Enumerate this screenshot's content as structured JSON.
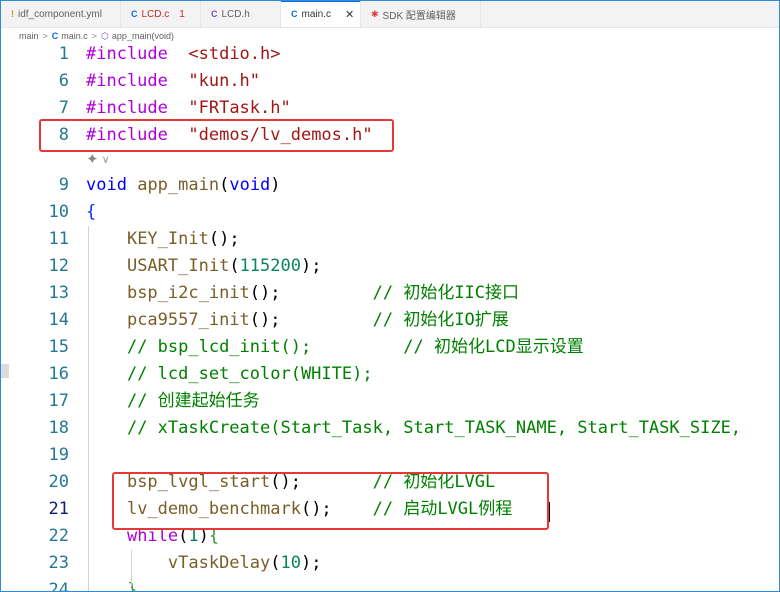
{
  "tabs": [
    {
      "icon": "!",
      "label": "idf_component.yml",
      "icon_color": "#c9a100"
    },
    {
      "icon": "C",
      "label": "LCD.c",
      "badge": "1",
      "icon_color": "#0a6cd6",
      "label_color": "#c62828"
    },
    {
      "icon": "C",
      "label": "LCD.h",
      "icon_color": "#7b4fbf"
    },
    {
      "icon": "C",
      "label": "main.c",
      "close": "✕",
      "active": true,
      "icon_color": "#0a6cd6"
    },
    {
      "icon": "✱",
      "label": "SDK 配置编辑器",
      "icon_color": "#e53935"
    }
  ],
  "breadcrumb": {
    "folder": "main",
    "separator": ">",
    "file": "main.c",
    "symbol": "app_main(void)"
  },
  "hint": {
    "icon": "sparkle-icon",
    "chevron": "∨"
  },
  "lines": [
    {
      "num": "1",
      "tokens": [
        [
          "pp",
          "#include"
        ],
        [
          "",
          "  "
        ],
        [
          "str",
          "<stdio.h>"
        ]
      ]
    },
    {
      "num": "6",
      "tokens": [
        [
          "pp",
          "#include"
        ],
        [
          "",
          "  "
        ],
        [
          "str",
          "\"kun.h\""
        ]
      ]
    },
    {
      "num": "7",
      "tokens": [
        [
          "pp",
          "#include"
        ],
        [
          "",
          "  "
        ],
        [
          "str",
          "\"FRTask.h\""
        ]
      ]
    },
    {
      "num": "8",
      "tokens": [
        [
          "pp",
          "#include"
        ],
        [
          "",
          "  "
        ],
        [
          "str",
          "\"demos/lv_demos.h\""
        ]
      ]
    },
    {
      "num": "9",
      "tokens": [
        [
          "kw",
          "void"
        ],
        [
          "",
          " "
        ],
        [
          "fn",
          "app_main"
        ],
        [
          "",
          "("
        ],
        [
          "kw",
          "void"
        ],
        [
          "",
          ")"
        ]
      ]
    },
    {
      "num": "10",
      "tokens": [
        [
          "brace1",
          "{"
        ]
      ]
    },
    {
      "num": "11",
      "tokens": [
        [
          "",
          "    "
        ],
        [
          "fn",
          "KEY_Init"
        ],
        [
          "",
          "();"
        ]
      ]
    },
    {
      "num": "12",
      "tokens": [
        [
          "",
          "    "
        ],
        [
          "fn",
          "USART_Init"
        ],
        [
          "",
          "("
        ],
        [
          "num",
          "115200"
        ],
        [
          "",
          ");"
        ]
      ]
    },
    {
      "num": "13",
      "tokens": [
        [
          "",
          "    "
        ],
        [
          "fn",
          "bsp_i2c_init"
        ],
        [
          "",
          "();         "
        ],
        [
          "cm",
          "// 初始化IIC接口"
        ]
      ]
    },
    {
      "num": "14",
      "tokens": [
        [
          "",
          "    "
        ],
        [
          "fn",
          "pca9557_init"
        ],
        [
          "",
          "();         "
        ],
        [
          "cm",
          "// 初始化IO扩展"
        ]
      ]
    },
    {
      "num": "15",
      "tokens": [
        [
          "",
          "    "
        ],
        [
          "cm",
          "// bsp_lcd_init();         // 初始化LCD显示设置"
        ]
      ]
    },
    {
      "num": "16",
      "tokens": [
        [
          "",
          "    "
        ],
        [
          "cm",
          "// lcd_set_color(WHITE);"
        ]
      ]
    },
    {
      "num": "17",
      "tokens": [
        [
          "",
          "    "
        ],
        [
          "cm",
          "// 创建起始任务"
        ]
      ]
    },
    {
      "num": "18",
      "tokens": [
        [
          "",
          "    "
        ],
        [
          "cm",
          "// xTaskCreate(Start_Task, Start_TASK_NAME, Start_TASK_SIZE,"
        ]
      ]
    },
    {
      "num": "19",
      "tokens": []
    },
    {
      "num": "20",
      "tokens": [
        [
          "",
          "    "
        ],
        [
          "fn",
          "bsp_lvgl_start"
        ],
        [
          "",
          "();       "
        ],
        [
          "cm",
          "// 初始化LVGL"
        ]
      ]
    },
    {
      "num": "21",
      "tokens": [
        [
          "",
          "    "
        ],
        [
          "fn",
          "lv_demo_benchmark"
        ],
        [
          "",
          "();    "
        ],
        [
          "cm",
          "// 启动LVGL例程"
        ]
      ],
      "current": true
    },
    {
      "num": "22",
      "tokens": [
        [
          "",
          "    "
        ],
        [
          "ctl",
          "while"
        ],
        [
          "",
          "("
        ],
        [
          "num",
          "1"
        ],
        [
          "",
          ")"
        ],
        [
          "brace2",
          "{"
        ]
      ]
    },
    {
      "num": "23",
      "tokens": [
        [
          "",
          "        "
        ],
        [
          "fn",
          "vTaskDelay"
        ],
        [
          "",
          "("
        ],
        [
          "num",
          "10"
        ],
        [
          "",
          ");"
        ]
      ]
    },
    {
      "num": "24",
      "tokens": [
        [
          "",
          "    "
        ],
        [
          "brace2",
          "}"
        ]
      ]
    }
  ],
  "colors": {
    "highlight_box": "#e53935",
    "line_number": "#237893",
    "active_tab_indicator": "#0a6cd6"
  }
}
